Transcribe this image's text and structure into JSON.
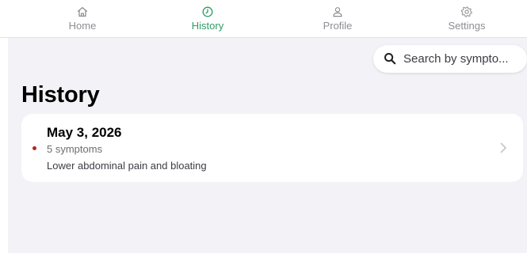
{
  "tabbar": {
    "tabs": [
      {
        "label": "Home",
        "icon": "home-icon"
      },
      {
        "label": "History",
        "icon": "clock-icon"
      },
      {
        "label": "Profile",
        "icon": "person-icon"
      },
      {
        "label": "Settings",
        "icon": "gear-icon"
      }
    ],
    "active": "History"
  },
  "search": {
    "placeholder": "Search by sympto..."
  },
  "main": {
    "title": "History",
    "entries": [
      {
        "date": "May 3, 2026",
        "symptom_count": "5 symptoms",
        "description": "Lower abdominal pain and bloating",
        "status_color": "#b3261e"
      }
    ]
  },
  "colors": {
    "accent": "#2e9b67",
    "inactive": "#8e8e93",
    "background": "#f2f2f7",
    "status_dot": "#b3261e"
  }
}
